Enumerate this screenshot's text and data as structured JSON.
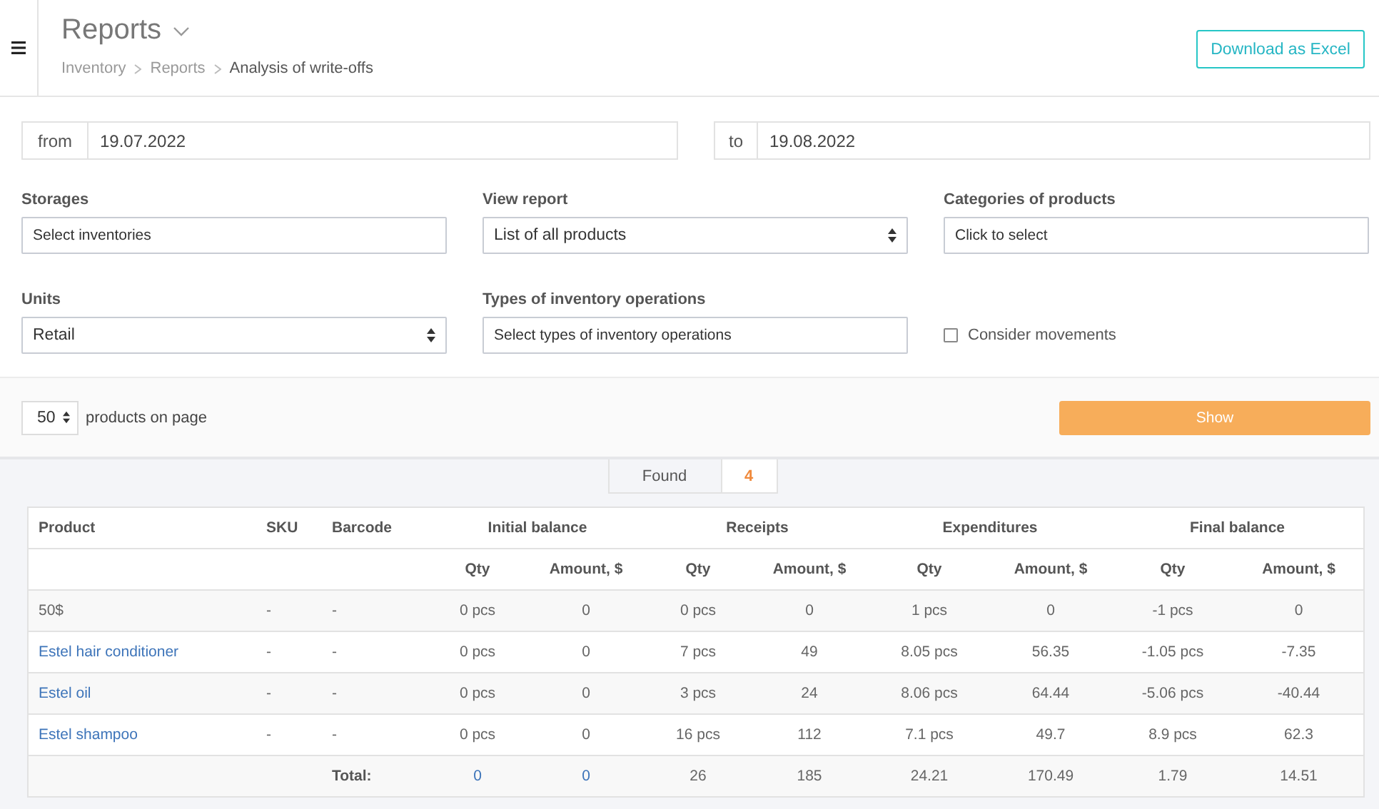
{
  "header": {
    "title": "Reports",
    "breadcrumbs": [
      {
        "label": "Inventory",
        "current": false
      },
      {
        "label": "Reports",
        "current": false
      },
      {
        "label": "Analysis of write-offs",
        "current": true
      }
    ],
    "download_button": "Download as Excel"
  },
  "dates": [
    {
      "label": "from",
      "value": "19.07.2022"
    },
    {
      "label": "to",
      "value": "19.08.2022"
    }
  ],
  "filters": [
    {
      "kind": "multiselect",
      "label": "Storages",
      "placeholder": "Select inventories"
    },
    {
      "kind": "select",
      "label": "View report",
      "value": "List of all products"
    },
    {
      "kind": "multiselect",
      "label": "Categories of products",
      "placeholder": "Click to select"
    },
    {
      "kind": "select",
      "label": "Units",
      "value": "Retail"
    },
    {
      "kind": "multiselect",
      "label": "Types of inventory operations",
      "placeholder": "Select types of inventory operations"
    },
    {
      "kind": "checkbox",
      "text": "Consider movements",
      "checked": false
    }
  ],
  "pager": {
    "page_size": "50",
    "label": "products on page",
    "show_button": "Show"
  },
  "found": {
    "label": "Found",
    "count": "4"
  },
  "table": {
    "columns": [
      "Product",
      "SKU",
      "Barcode"
    ],
    "groups": [
      "Initial balance",
      "Receipts",
      "Expenditures",
      "Final balance"
    ],
    "subcolumns": [
      "Qty",
      "Amount, $",
      "Qty",
      "Amount, $",
      "Qty",
      "Amount, $",
      "Qty",
      "Amount, $"
    ],
    "rows": [
      {
        "product": "50$",
        "linked": false,
        "sku": "-",
        "barcode": "-",
        "values": [
          "0 pcs",
          "0",
          "0 pcs",
          "0",
          "1 pcs",
          "0",
          "-1 pcs",
          "0"
        ]
      },
      {
        "product": "Estel hair conditioner",
        "linked": true,
        "sku": "-",
        "barcode": "-",
        "values": [
          "0 pcs",
          "0",
          "7 pcs",
          "49",
          "8.05 pcs",
          "56.35",
          "-1.05 pcs",
          "-7.35"
        ]
      },
      {
        "product": "Estel oil",
        "linked": true,
        "sku": "-",
        "barcode": "-",
        "values": [
          "0 pcs",
          "0",
          "3 pcs",
          "24",
          "8.06 pcs",
          "64.44",
          "-5.06 pcs",
          "-40.44"
        ]
      },
      {
        "product": "Estel shampoo",
        "linked": true,
        "sku": "-",
        "barcode": "-",
        "values": [
          "0 pcs",
          "0",
          "16 pcs",
          "112",
          "7.1 pcs",
          "49.7",
          "8.9 pcs",
          "62.3"
        ]
      }
    ],
    "totals": {
      "label": "Total:",
      "cells": [
        {
          "text": "0",
          "linked": true
        },
        {
          "text": "0",
          "linked": true
        },
        {
          "text": "26",
          "linked": false
        },
        {
          "text": "185",
          "linked": false
        },
        {
          "text": "24.21",
          "linked": false
        },
        {
          "text": "170.49",
          "linked": false
        },
        {
          "text": "1.79",
          "linked": false
        },
        {
          "text": "14.51",
          "linked": false
        }
      ]
    }
  }
}
